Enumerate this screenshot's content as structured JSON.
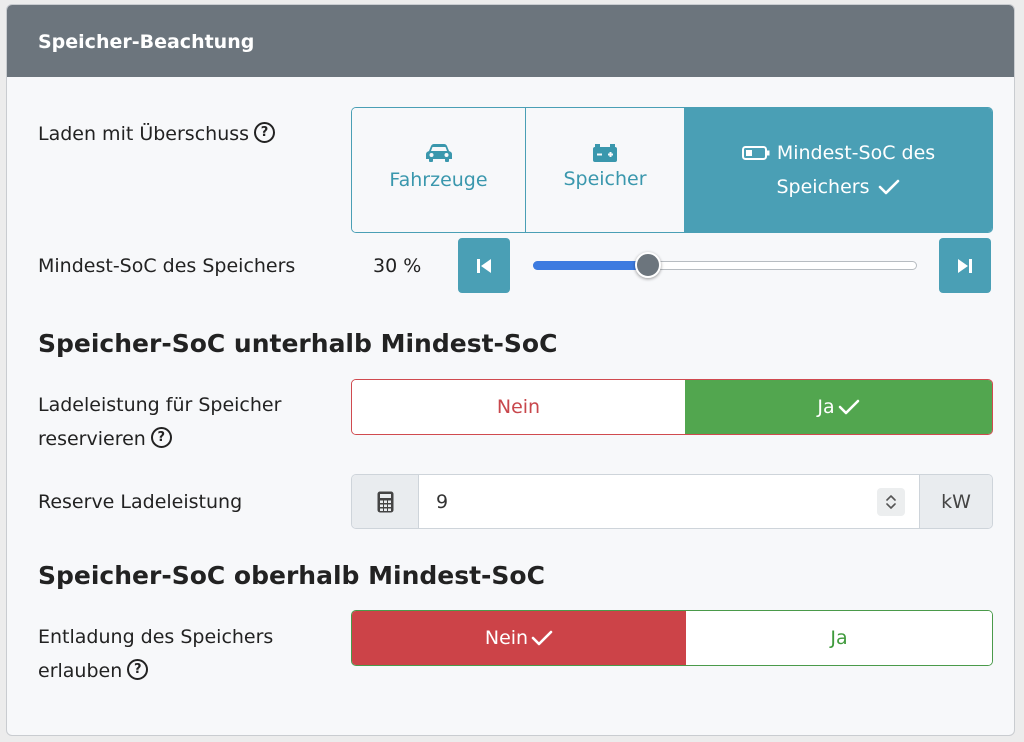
{
  "card": {
    "title": "Speicher-Beachtung"
  },
  "surplus": {
    "label": "Laden mit Überschuss",
    "options": [
      {
        "label": "Fahrzeuge",
        "icon": "car-icon",
        "active": false
      },
      {
        "label": "Speicher",
        "icon": "battery-charge-icon",
        "active": false
      },
      {
        "label_line1": "Mindest-SoC des",
        "label_line2": "Speichers",
        "icon": "battery-icon",
        "active": true
      }
    ]
  },
  "min_soc": {
    "label": "Mindest-SoC des Speichers",
    "value_text": "30 %",
    "value": 30,
    "min": 0,
    "max": 100
  },
  "below": {
    "title": "Speicher-SoC unterhalb Mindest-SoC",
    "reserve_label_line1": "Ladeleistung für Speicher",
    "reserve_label_line2": "reservieren",
    "no_label": "Nein",
    "yes_label": "Ja",
    "selected": "yes",
    "power_label": "Reserve Ladeleistung",
    "power_value": "9",
    "power_unit": "kW"
  },
  "above": {
    "title": "Speicher-SoC oberhalb Mindest-SoC",
    "discharge_label_line1": "Entladung des Speichers",
    "discharge_label_line2": "erlauben",
    "no_label": "Nein",
    "yes_label": "Ja",
    "selected": "no"
  },
  "colors": {
    "accent": "#4a9fb5",
    "header": "#6c757d",
    "success": "#52a64f",
    "danger": "#cc4348",
    "slider_fill": "#3d7be0"
  }
}
